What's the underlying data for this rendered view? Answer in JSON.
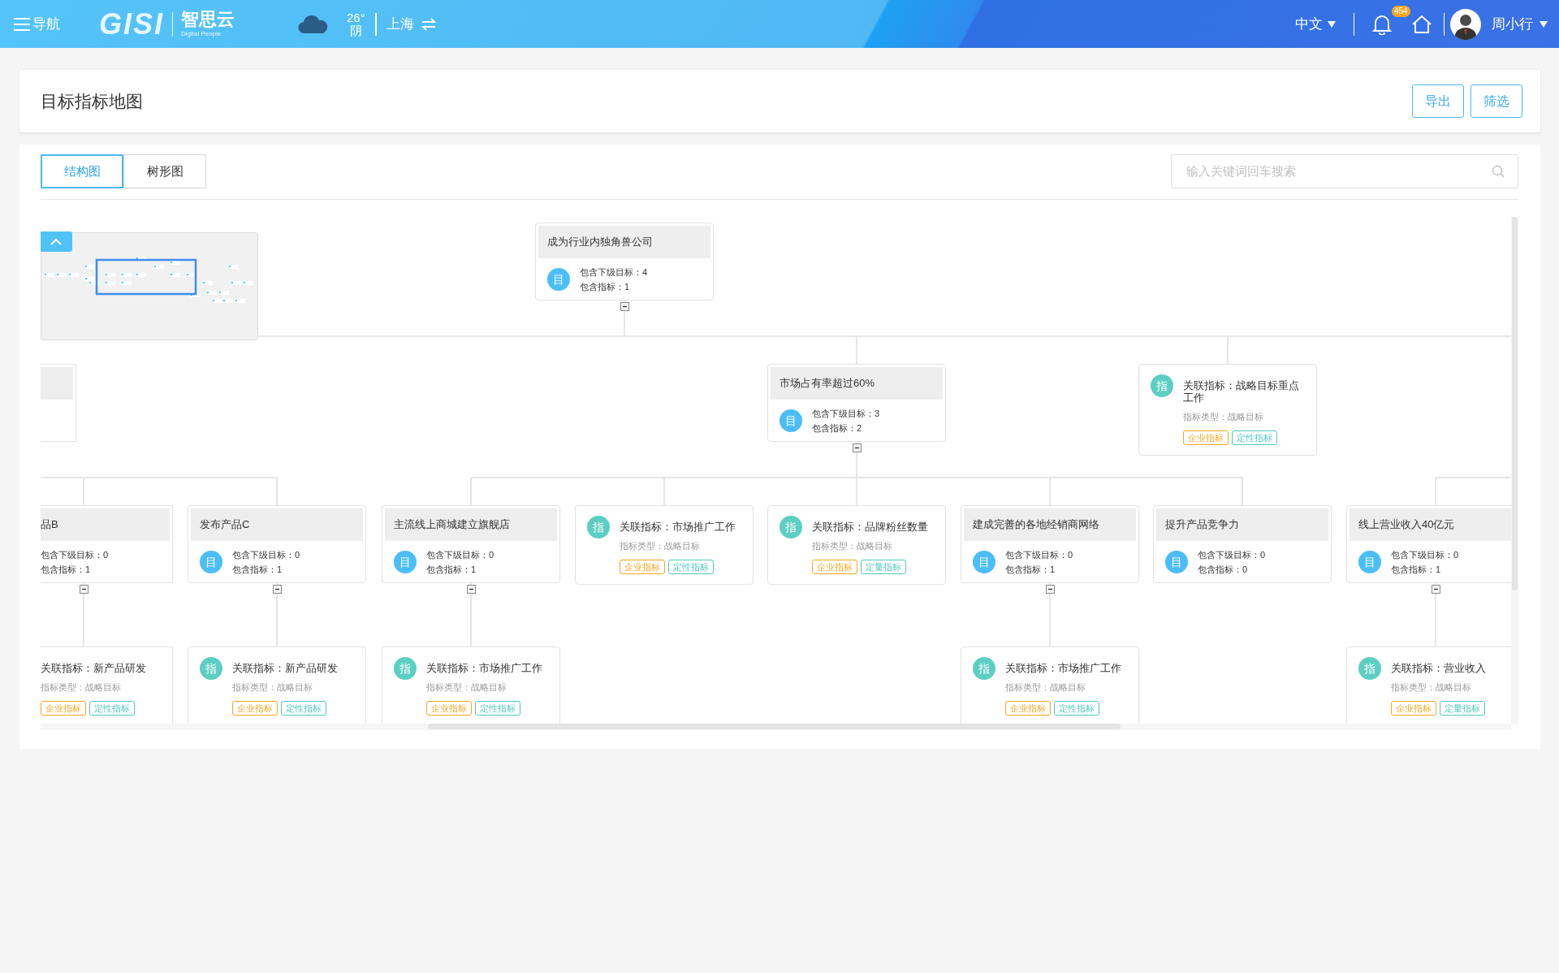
{
  "header": {
    "menu_label": "导航",
    "logo_text": "GISI",
    "logo_cn": "智思云",
    "logo_sub": "Digital People",
    "temperature": "26°",
    "weather": "阴",
    "city": "上海",
    "language": "中文",
    "notification_count": "454",
    "user": "周小行"
  },
  "page_title": "目标指标地图",
  "actions": [
    "导出",
    "筛选"
  ],
  "view_tabs": [
    {
      "label": "结构图",
      "selected": true
    },
    {
      "label": "树形图",
      "selected": false
    }
  ],
  "search": {
    "placeholder": "输入关键词回车搜索"
  },
  "tree": {
    "kind": "goal",
    "title": "成为行业内独角兽公司",
    "badge": "目",
    "stats": [
      "包含下级目标：4",
      "包含指标：1"
    ],
    "expanded": true,
    "children": [
      {
        "kind": "goal",
        "cut_left": true,
        "children": [
          {
            "kind": "goal",
            "cut_left": true,
            "title": "品B",
            "stats": [
              "包含下级目标：0",
              "包含指标：1"
            ],
            "expanded": true,
            "children": [
              {
                "kind": "indicator",
                "cut_left": true,
                "title": "关联指标：新产品研发",
                "type_line": "指标类型：战略目标",
                "tags": [
                  {
                    "label": "企业指标",
                    "color": "#f5a623"
                  },
                  {
                    "label": "定性指标",
                    "color": "#4dc9c0"
                  }
                ]
              }
            ]
          },
          {
            "kind": "goal",
            "title": "发布产品C",
            "badge": "目",
            "stats": [
              "包含下级目标：0",
              "包含指标：1"
            ],
            "expanded": true,
            "children": [
              {
                "kind": "indicator",
                "badge": "指",
                "title": "关联指标：新产品研发",
                "type_line": "指标类型：战略目标",
                "tags": [
                  {
                    "label": "企业指标",
                    "color": "#f5a623"
                  },
                  {
                    "label": "定性指标",
                    "color": "#4dc9c0"
                  }
                ]
              }
            ]
          }
        ]
      },
      {
        "kind": "goal",
        "title": "市场占有率超过60%",
        "badge": "目",
        "stats": [
          "包含下级目标：3",
          "包含指标：2"
        ],
        "expanded": true,
        "children": [
          {
            "kind": "goal",
            "title": "主流线上商城建立旗舰店",
            "badge": "目",
            "stats": [
              "包含下级目标：0",
              "包含指标：1"
            ],
            "expanded": true,
            "children": [
              {
                "kind": "indicator",
                "badge": "指",
                "title": "关联指标：市场推广工作",
                "type_line": "指标类型：战略目标",
                "tags": [
                  {
                    "label": "企业指标",
                    "color": "#f5a623"
                  },
                  {
                    "label": "定性指标",
                    "color": "#4dc9c0"
                  }
                ]
              }
            ]
          },
          {
            "kind": "indicator",
            "badge": "指",
            "title": "关联指标：市场推广工作",
            "type_line": "指标类型：战略目标",
            "tags": [
              {
                "label": "企业指标",
                "color": "#f5a623"
              },
              {
                "label": "定性指标",
                "color": "#4dc9c0"
              }
            ]
          },
          {
            "kind": "indicator",
            "badge": "指",
            "title": "关联指标：品牌粉丝数量",
            "type_line": "指标类型：战略目标",
            "tags": [
              {
                "label": "企业指标",
                "color": "#f5a623"
              },
              {
                "label": "定量指标",
                "color": "#4dc9c0"
              }
            ]
          },
          {
            "kind": "goal",
            "title": "建成完善的各地经销商网络",
            "badge": "目",
            "stats": [
              "包含下级目标：0",
              "包含指标：1"
            ],
            "expanded": true,
            "children": [
              {
                "kind": "indicator",
                "badge": "指",
                "title": "关联指标：市场推广工作",
                "type_line": "指标类型：战略目标",
                "tags": [
                  {
                    "label": "企业指标",
                    "color": "#f5a623"
                  },
                  {
                    "label": "定性指标",
                    "color": "#4dc9c0"
                  }
                ]
              }
            ]
          },
          {
            "kind": "goal",
            "title": "提升产品竞争力",
            "badge": "目",
            "stats": [
              "包含下级目标：0",
              "包含指标：0"
            ]
          }
        ]
      },
      {
        "kind": "indicator",
        "badge": "指",
        "title": "关联指标：战略目标重点工作",
        "type_line": "指标类型：战略目标",
        "tags": [
          {
            "label": "企业指标",
            "color": "#f5a623"
          },
          {
            "label": "定性指标",
            "color": "#4dc9c0"
          }
        ]
      }
    ]
  },
  "detached_nodes": [
    {
      "kind": "goal",
      "title": "线上营业收入40亿元",
      "badge": "目",
      "stats": [
        "包含下级目标：0",
        "包含指标：1"
      ],
      "expanded": true,
      "children": [
        {
          "kind": "indicator",
          "badge": "指",
          "title": "关联指标：营业收入",
          "type_line": "指标类型：战略目标",
          "tags": [
            {
              "label": "企业指标",
              "color": "#f5a623"
            },
            {
              "label": "定量指标",
              "color": "#4dc9c0"
            }
          ]
        }
      ]
    }
  ]
}
